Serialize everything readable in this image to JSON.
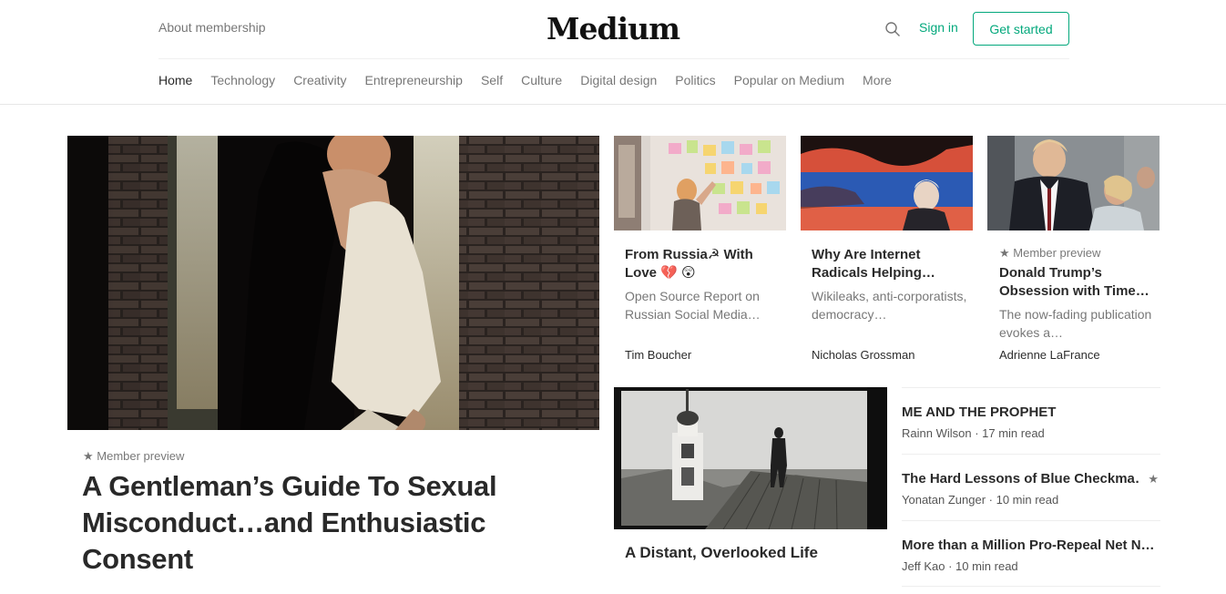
{
  "header": {
    "about_label": "About membership",
    "logo": "Medium",
    "signin_label": "Sign in",
    "get_started_label": "Get started"
  },
  "nav": [
    "Home",
    "Technology",
    "Creativity",
    "Entrepreneurship",
    "Self",
    "Culture",
    "Digital design",
    "Politics",
    "Popular on Medium",
    "More"
  ],
  "colors": {
    "accent": "#03a87c"
  },
  "hero": {
    "preview": "★ Member preview",
    "title": "A Gentleman’s Guide To Sexual Misconduct…and Enthusiastic Consent"
  },
  "cards": [
    {
      "title": "From Russia☭ With Love 💔 😲",
      "subtitle": "Open Source Report on Russian Social Media…",
      "author": "Tim Boucher"
    },
    {
      "title": "Why Are Internet Radicals Helping…",
      "subtitle": "Wikileaks, anti-corporatists, democracy…",
      "author": "Nicholas Grossman"
    },
    {
      "preview": "★ Member preview",
      "title": "Donald Trump’s Obsession with Time…",
      "subtitle": "The now-fading publication evokes a…",
      "author": "Adrienne LaFrance"
    }
  ],
  "distant": {
    "title": "A Distant, Overlooked Life"
  },
  "list": [
    {
      "title": "ME AND THE PROPHET",
      "meta": "Rainn Wilson · 17 min read"
    },
    {
      "title": "The Hard Lessons of Blue Checkma…",
      "meta": "Yonatan Zunger · 10 min read",
      "star": "★"
    },
    {
      "title": "More than a Million Pro-Repeal Net N…",
      "meta": "Jeff Kao · 10 min read"
    }
  ]
}
